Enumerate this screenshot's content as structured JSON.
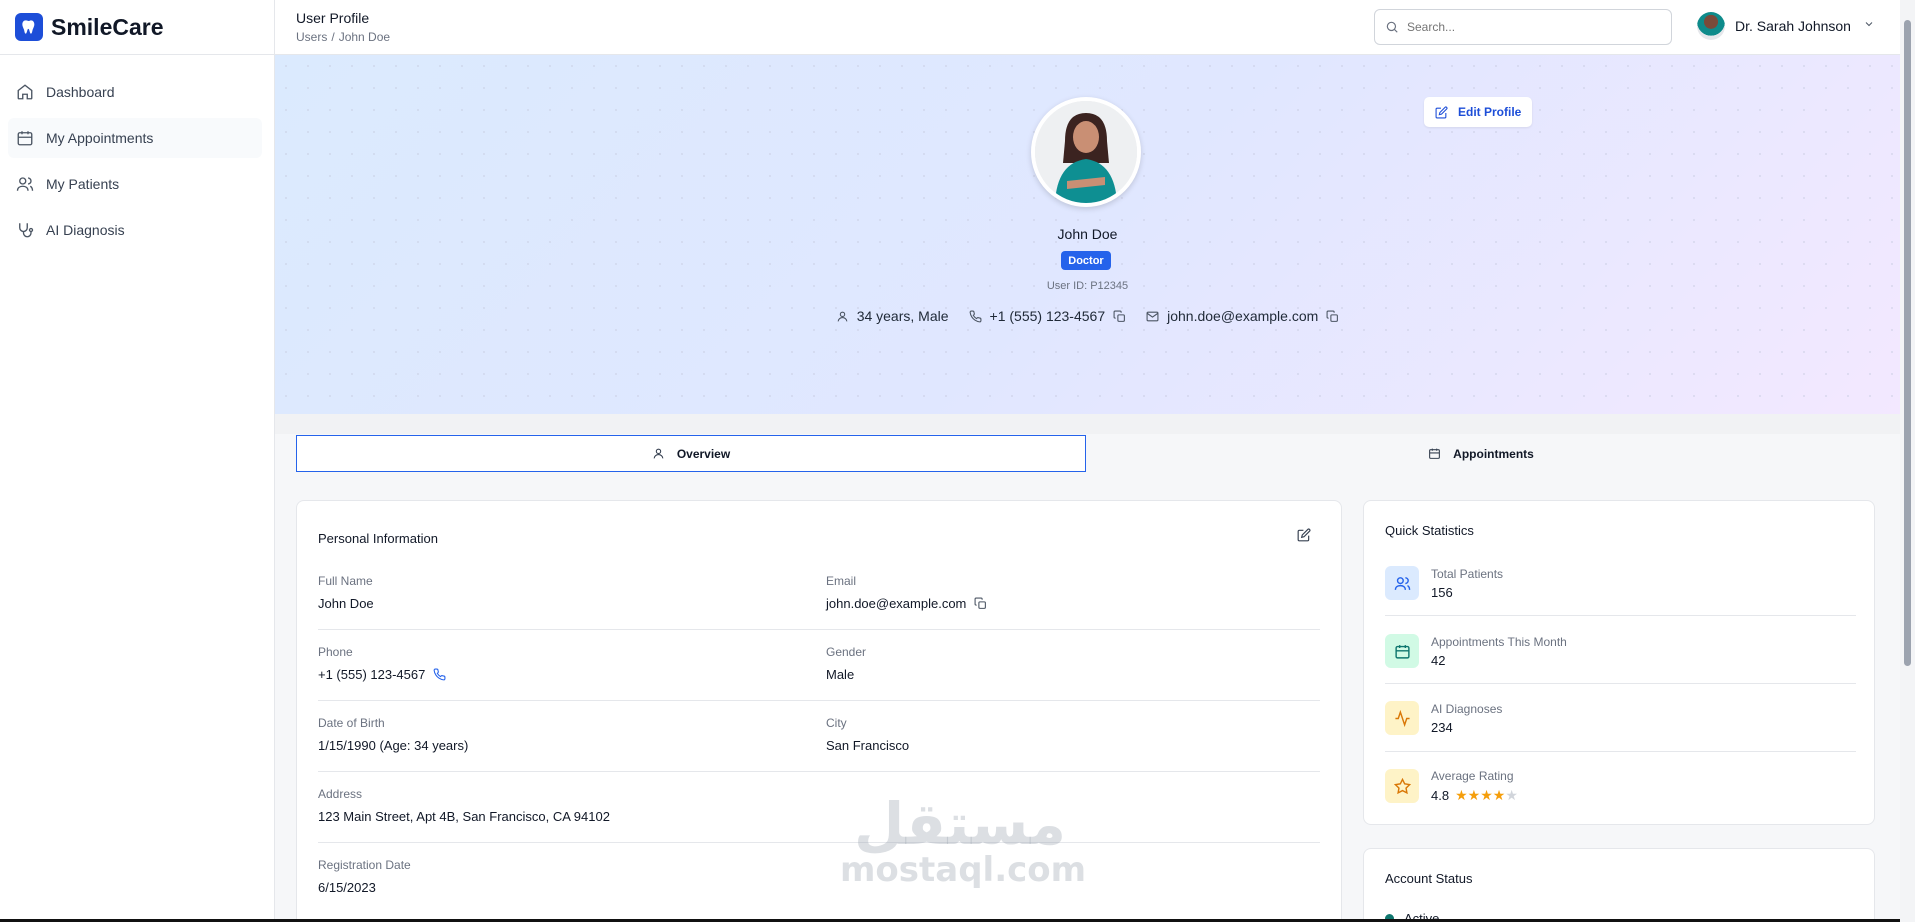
{
  "brand": {
    "name": "SmileCare"
  },
  "sidebar": {
    "items": [
      {
        "label": "Dashboard",
        "icon": "home-icon"
      },
      {
        "label": "My Appointments",
        "icon": "calendar-icon"
      },
      {
        "label": "My Patients",
        "icon": "users-icon"
      },
      {
        "label": "AI Diagnosis",
        "icon": "stethoscope-icon"
      }
    ]
  },
  "header": {
    "title": "User Profile",
    "breadcrumb": [
      "Users",
      "/",
      "John Doe"
    ],
    "search_placeholder": "Search...",
    "user_name": "Dr. Sarah Johnson"
  },
  "profile": {
    "edit_label": "Edit Profile",
    "name": "John Doe",
    "role": "Doctor",
    "user_id": "User ID: P12345",
    "age_gender": "34 years, Male",
    "phone": "+1 (555) 123-4567",
    "email": "john.doe@example.com"
  },
  "tabs": [
    {
      "label": "Overview",
      "active": true
    },
    {
      "label": "Appointments",
      "active": false
    }
  ],
  "personal_info": {
    "title": "Personal Information",
    "fields": [
      {
        "label": "Full Name",
        "value": "John Doe"
      },
      {
        "label": "Email",
        "value": "john.doe@example.com"
      },
      {
        "label": "Phone",
        "value": "+1 (555) 123-4567"
      },
      {
        "label": "Gender",
        "value": "Male"
      },
      {
        "label": "Date of Birth",
        "value": "1/15/1990 (Age: 34 years)"
      },
      {
        "label": "City",
        "value": "San Francisco"
      },
      {
        "label": "Address",
        "value": "123 Main Street, Apt 4B, San Francisco, CA 94102"
      },
      {
        "label": "Registration Date",
        "value": "6/15/2023"
      }
    ]
  },
  "quick_stats": {
    "title": "Quick Statistics",
    "items": [
      {
        "label": "Total Patients",
        "value": "156",
        "color": "#2563eb",
        "bg": "#dbeafe"
      },
      {
        "label": "Appointments This Month",
        "value": "42",
        "color": "#0f766e",
        "bg": "#d1fae5"
      },
      {
        "label": "AI Diagnoses",
        "value": "234",
        "color": "#d97706",
        "bg": "#fef3c7"
      },
      {
        "label": "Average Rating",
        "value": "4.8",
        "color": "#d97706",
        "bg": "#fef3c7",
        "stars": 4
      }
    ]
  },
  "account_status": {
    "title": "Account Status",
    "status": "Active"
  },
  "watermark": {
    "arabic": "مستقل",
    "latin": "mostaql.com"
  },
  "colors": {
    "accent": "#2563eb",
    "brand": "#1d4ed8"
  }
}
